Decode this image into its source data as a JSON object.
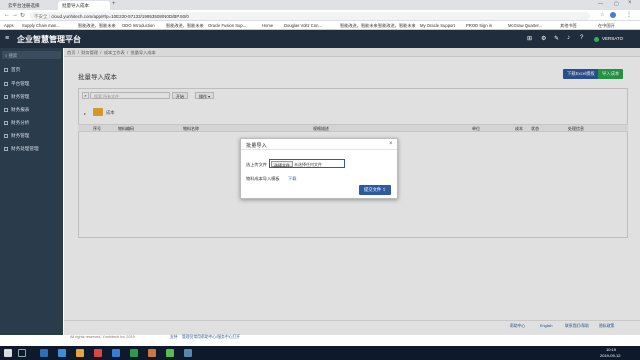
{
  "browser": {
    "tabs": [
      {
        "label": "云平台注册选择"
      },
      {
        "label": "批量导入成本"
      }
    ],
    "url_security": "不安全",
    "url": "cloud.yunhitech.com/app/#/p=10E230-57133/19953508/N0D/BP.50/0",
    "bookmarks": [
      "Apps",
      "Supply Chain man...",
      "智能改进，智能未来",
      "ODO Introduction",
      "智能改进，智能未来",
      "Oracle Fusion Sup...",
      "Home",
      "Douglas Voltz Con...",
      "智能改进，智能未来",
      "智能改进，智能未来",
      "My Oracle Support",
      "PROD Sign in",
      "McGraw Quarter...",
      "其他书签",
      "在中国开"
    ]
  },
  "app": {
    "title": "企业智慧管理平台",
    "user": "VERSATO"
  },
  "sidebar": {
    "search_placeholder": "搜索",
    "items": [
      {
        "label": "首页"
      },
      {
        "label": "平台管理"
      },
      {
        "label": "财务管理"
      },
      {
        "label": "财务报表"
      },
      {
        "label": "财务分析"
      },
      {
        "label": "财务管理"
      },
      {
        "label": "财务处理管理"
      }
    ]
  },
  "breadcrumb": [
    "首页",
    "财务管理",
    "成本工作表",
    "批量导入成本"
  ],
  "page": {
    "title": "批量导入成本",
    "btn_download": "下载Excel模板",
    "btn_import": "导入成本",
    "search_placeholder": "搜索 所有文件",
    "btn_search": "开始",
    "btn_ops": "操作",
    "folder_label": "成本",
    "table_headers": [
      "序号",
      "物料编码",
      "物料名称",
      "规格描述",
      "单位",
      "成本",
      "状态",
      "处理信息"
    ]
  },
  "dialog": {
    "title": "批量导入",
    "label_select": "选上传文件",
    "btn_choose": "选择文件",
    "file_text": "未选择任何文件",
    "label_template": "物料成本导入模板",
    "link_download": "下载",
    "btn_submit": "提交文件"
  },
  "footer": {
    "copyright": "All rights reserved, Yunhitech Inc 2019",
    "link1": "支持",
    "link2": "管理员常用帮助中心/服务中心打开",
    "links_right": [
      "帮助中心",
      "English",
      "联系我们/帮助",
      "隐私政策"
    ]
  },
  "taskbar": {
    "time": "10:19",
    "date": "2019-09-12"
  },
  "colors": {
    "header_bg": "#1f2d3d",
    "sidebar_bg": "#2a3b4c",
    "primary": "#2e5aa0",
    "success": "#2aa84a"
  }
}
